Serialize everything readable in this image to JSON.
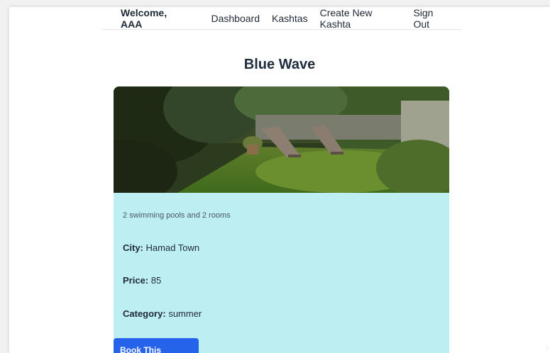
{
  "nav": {
    "welcome": "Welcome, AAA",
    "links": [
      "Dashboard",
      "Kashtas",
      "Create New Kashta",
      "Sign Out"
    ]
  },
  "kashta": {
    "title": "Blue Wave",
    "description": "2 swimming pools and 2 rooms",
    "city_label": "City:",
    "city": "Hamad Town",
    "price_label": "Price:",
    "price": "85",
    "category_label": "Category:",
    "category": "summer",
    "book_label": "Book This Kashta"
  },
  "colors": {
    "card_bg": "#bdeff2",
    "button_bg": "#2563eb",
    "title": "#1f2d3d"
  }
}
